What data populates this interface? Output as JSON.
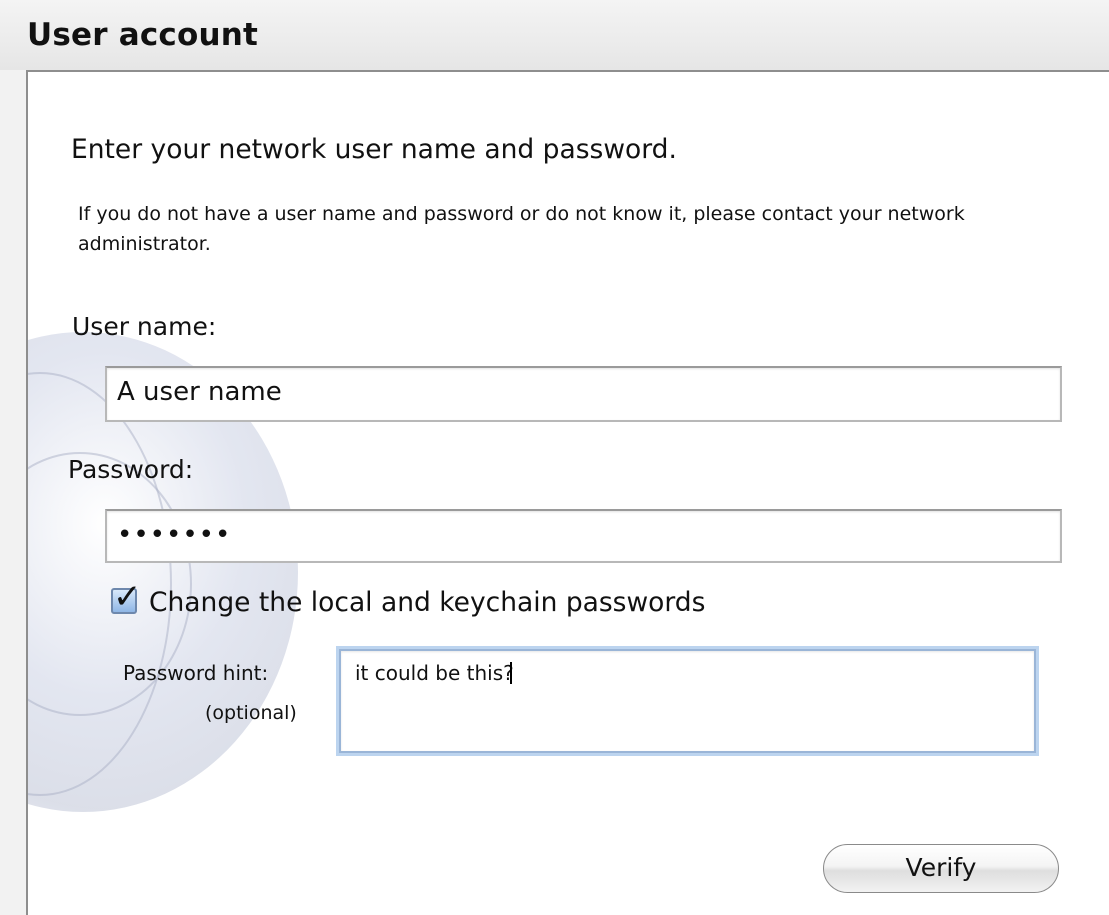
{
  "header": {
    "title": "User account"
  },
  "form": {
    "heading": "Enter your network user name and password.",
    "info": "If you do not have a user name and password or do not know it, please contact your network administrator.",
    "username_label": "User name:",
    "username_value": "A user name",
    "password_label": "Password:",
    "password_value": "•••••••",
    "change_passwords_checked": true,
    "change_passwords_label": "Change the local and keychain passwords",
    "hint_label": "Password hint:",
    "hint_optional": "(optional)",
    "hint_value": "it could be this?",
    "verify_label": "Verify"
  },
  "colors": {
    "focus_ring": "#bcd4ef",
    "checkbox_fill": "#8fb6e6"
  }
}
